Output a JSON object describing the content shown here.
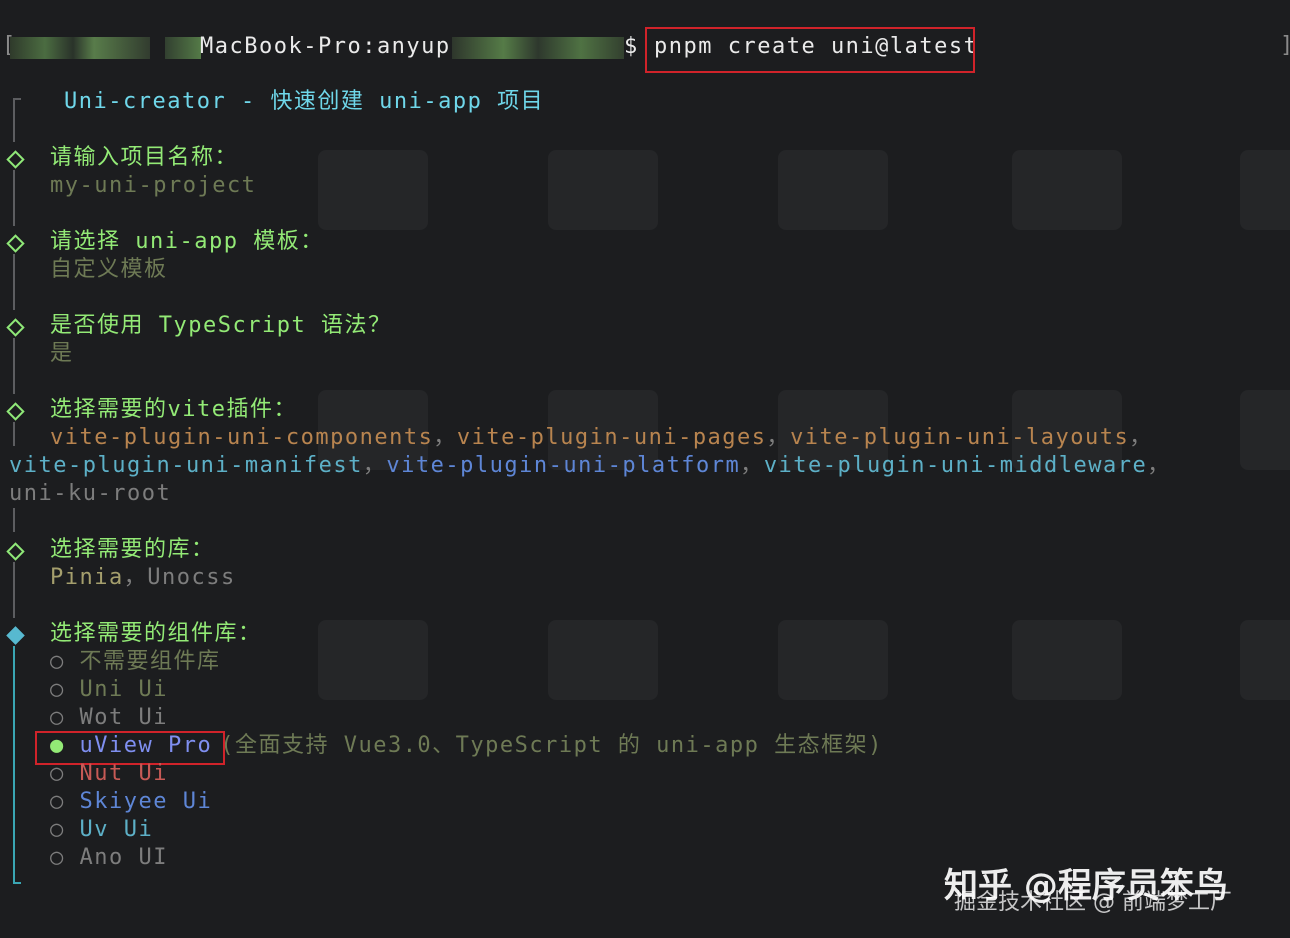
{
  "prompt": {
    "host": "MacBook-Pro:anyup",
    "symbol": "$",
    "command": "pnpm create uni@latest"
  },
  "header": {
    "title": "Uni-creator - 快速创建 uni-app 项目"
  },
  "questions": [
    {
      "label": "请输入项目名称：",
      "answer": "my-uni-project"
    },
    {
      "label": "请选择 uni-app 模板：",
      "answer": "自定义模板"
    },
    {
      "label": "是否使用 TypeScript 语法？",
      "answer": "是"
    },
    {
      "label": "选择需要的vite插件：",
      "answer_items": [
        "vite-plugin-uni-components",
        "vite-plugin-uni-pages",
        "vite-plugin-uni-layouts",
        "vite-plugin-uni-manifest",
        "vite-plugin-uni-platform",
        "vite-plugin-uni-middleware",
        "uni-ku-root"
      ],
      "sep": "，"
    },
    {
      "label": "选择需要的库：",
      "answer_items": [
        "Pinia",
        "Unocss"
      ],
      "sep": "，"
    }
  ],
  "component_select": {
    "label": "选择需要的组件库：",
    "options": [
      {
        "bullet": "○",
        "label": "不需要组件库",
        "color": "#6e7a55"
      },
      {
        "bullet": "○",
        "label": "Uni Ui",
        "color": "#6e7a55"
      },
      {
        "bullet": "○",
        "label": "Wot Ui",
        "color": "#7d7d7d"
      },
      {
        "bullet": "●",
        "label": "uView Pro",
        "hint": "(全面支持 Vue3.0、TypeScript 的 uni-app 生态框架)",
        "selected": true,
        "color": "#5e86d6"
      },
      {
        "bullet": "○",
        "label": "Nut Ui",
        "color": "#c75a56"
      },
      {
        "bullet": "○",
        "label": "Skiyee Ui",
        "color": "#5e86d6"
      },
      {
        "bullet": "○",
        "label": "Uv Ui",
        "color": "#5db0c7"
      },
      {
        "bullet": "○",
        "label": "Ano UI",
        "color": "#7d7d7d"
      }
    ]
  },
  "watermark": {
    "primary": "知乎 @程序员笨鸟",
    "secondary": "掘金技术社区 @ 前端梦工厂"
  },
  "colors": {
    "background": "#1c1d1f",
    "cyan": "#6fd7ea",
    "green": "#93ea76",
    "highlight_border": "#d0232a"
  }
}
